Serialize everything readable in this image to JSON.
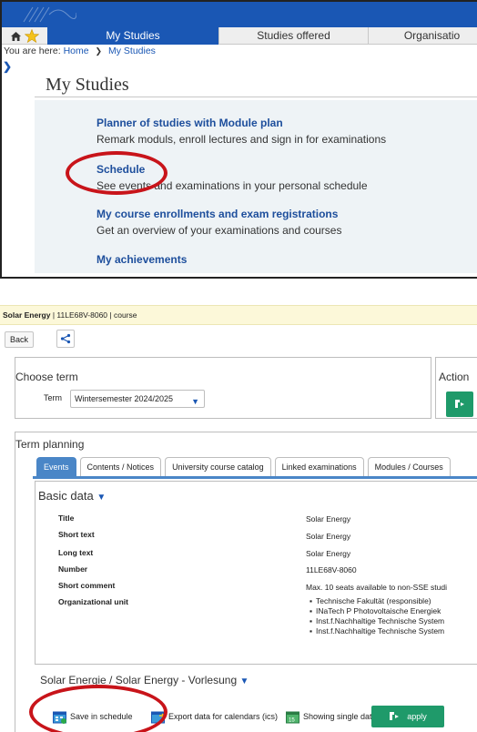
{
  "top_nav": {
    "tabs": [
      "My Studies",
      "Studies offered",
      "Organisatio"
    ]
  },
  "breadcrumb": {
    "prefix": "You are here:",
    "home": "Home",
    "current": "My Studies"
  },
  "page_title": "My Studies",
  "menu": [
    {
      "label": "Planner of studies with Module plan",
      "desc": "Remark moduls, enroll lectures and sign in for examinations"
    },
    {
      "label": "Schedule",
      "desc": "See events and examinations in your personal schedule"
    },
    {
      "label": "My course enrollments and exam registrations",
      "desc": "Get an overview of your examinations and courses"
    },
    {
      "label": "My achievements",
      "desc": ""
    }
  ],
  "course_header": {
    "title": "Solar Energy",
    "sep": "|",
    "number": "11LE68V-8060",
    "kind": "course"
  },
  "actions": {
    "back": "Back"
  },
  "choose_term": {
    "heading": "Choose term",
    "term_label": "Term",
    "term_value": "Wintersemester 2024/2025",
    "actions_heading": "Action"
  },
  "term_planning": {
    "heading": "Term planning",
    "tabs": [
      "Events",
      "Contents / Notices",
      "University course catalog",
      "Linked examinations",
      "Modules / Courses"
    ]
  },
  "basic_data": {
    "heading": "Basic data",
    "rows": [
      {
        "key": "Title",
        "value": "Solar Energy"
      },
      {
        "key": "Short text",
        "value": "Solar Energy"
      },
      {
        "key": "Long text",
        "value": "Solar Energy"
      },
      {
        "key": "Number",
        "value": "11LE68V-8060"
      },
      {
        "key": "Short comment",
        "value": "Max. 10 seats available to non-SSE studi"
      }
    ],
    "org_label": "Organizational unit",
    "org_units": [
      "Technische Fakultät (responsible)",
      "INaTech P Photovoltaische Energiek",
      "Inst.f.Nachhaltige Technische System",
      "Inst.f.Nachhaltige Technische System"
    ]
  },
  "lecture": {
    "heading": "Solar Energie / Solar Energy - Vorlesung",
    "save_schedule": "Save in schedule",
    "export": "Export data for calendars (ics)",
    "single_dates": "Showing single dates.",
    "apply": "apply"
  },
  "colors": {
    "brand_blue": "#1a57b4",
    "link_blue": "#1d4e9c",
    "accent_green": "#1f9a6a",
    "highlight_red": "#c8141a",
    "crumb_bg": "#fcf8d9"
  }
}
